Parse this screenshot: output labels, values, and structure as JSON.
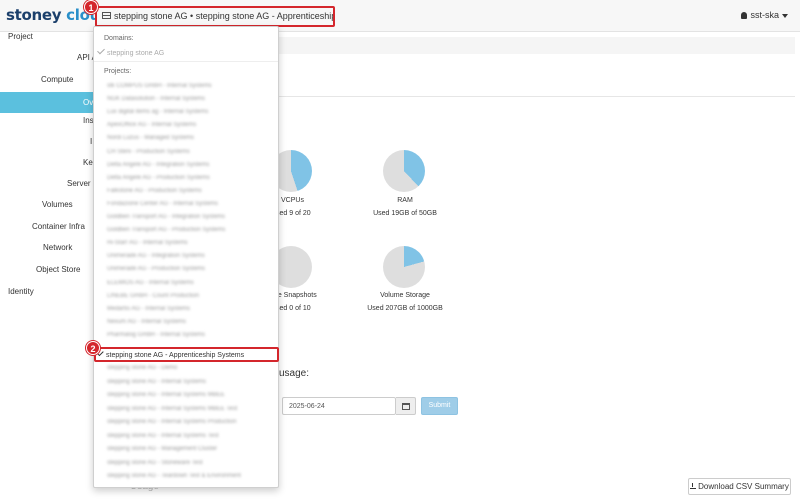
{
  "brand": {
    "part1": "stoney",
    "part2": " cloud"
  },
  "project_switcher": {
    "label": "stepping stone AG • stepping stone AG - Apprenticeship Systems"
  },
  "user": {
    "name": "sst-ska"
  },
  "badges": {
    "first": "1",
    "second": "2"
  },
  "sidebar": {
    "items": [
      {
        "label": "Project"
      },
      {
        "label": "API A"
      },
      {
        "label": "Compute"
      },
      {
        "label": "Ov"
      },
      {
        "label": "Ins"
      },
      {
        "label": "I"
      },
      {
        "label": "Ke"
      },
      {
        "label": "Server G"
      },
      {
        "label": "Volumes"
      },
      {
        "label": "Container Infra"
      },
      {
        "label": "Network"
      },
      {
        "label": "Object Store"
      },
      {
        "label": "Identity"
      }
    ]
  },
  "dropdown": {
    "domains_header": "Domains:",
    "domain": "stepping stone AG",
    "projects_header": "Projects:",
    "projects_above": [
      "stk COMPUS GmbH - Internal Systems",
      "NGK Datasolution - Internal Systems",
      "Lux digital items ag - Internal Systems",
      "ApexOffice AG - Internal Systems",
      "Nordi Luzus - Managed Systems",
      "CH Steni - Production Systems",
      "Delta Angele AG - Integration Systems",
      "Delta Angele AG - Production Systems",
      "Falkstone AG - Production Systems",
      "Fondazione Center AG - Internal Systems",
      "Goldberi Transport AG - Integration Systems",
      "Goldberi Transport AG - Production Systems",
      "Hi-Starr AG - Internal Systems",
      "Unimerade AG - Integration Systems",
      "Unimerade AG - Production Systems",
      "ELEMIOS AG - Internal Systems",
      "LINEBE GmbH - Count Production",
      "Medartis AG - Internal Systems",
      "Nexum AG - Internal Systems",
      "Pharmalog GmbH - Internal Systems"
    ],
    "selected_project": "stepping stone AG - Apprenticeship Systems",
    "projects_below": [
      "stepping stone AG - Demo",
      "stepping stone AG - Internal Systems",
      "stepping stone AG - Internal Systems MBEE",
      "stepping stone AG - Internal Systems MBEE Test",
      "stepping stone AG - Internal Systems Production",
      "stepping stone AG - Internal Systems Test",
      "stepping stone AG - Management Cluster",
      "stepping stone AG - Stoneware Test",
      "stepping stone AG - Teardown Test & Environment"
    ]
  },
  "quotas": [
    {
      "name": "VCPUs",
      "usage": "Used 9 of 20",
      "used": 9,
      "total": 20
    },
    {
      "name": "RAM",
      "usage": "Used 19GB of 50GB",
      "used": 19,
      "total": 50
    },
    {
      "name": "Volume Snapshots",
      "usage": "Used 0 of 10",
      "used": 0,
      "total": 10
    },
    {
      "name": "Volume Storage",
      "usage": "Used 207GB of 1000GB",
      "used": 207,
      "total": 1000
    }
  ],
  "quota_labels_visible": {
    "q1_name": "VCPUs",
    "q1_usage": "sed 9 of 20",
    "q2_name": "RAM",
    "q2_usage": "Used 19GB of 50GB",
    "q3_name": "me Snapshots",
    "q3_usage": "sed 0 of 10",
    "q4_name": "Volume Storage",
    "q4_usage": "Used 207GB of 1000GB"
  },
  "colors": {
    "pie_used": "#80c3e6",
    "pie_free": "#dedede",
    "accent": "#5bc0de",
    "highlight": "#d4262c"
  },
  "usage_form": {
    "title": "usage:",
    "date_value": "2025-06-24",
    "submit_label": "Submit"
  },
  "download_csv": {
    "label": "Download CSV Summary"
  },
  "usage_heading_faded": "Usage"
}
